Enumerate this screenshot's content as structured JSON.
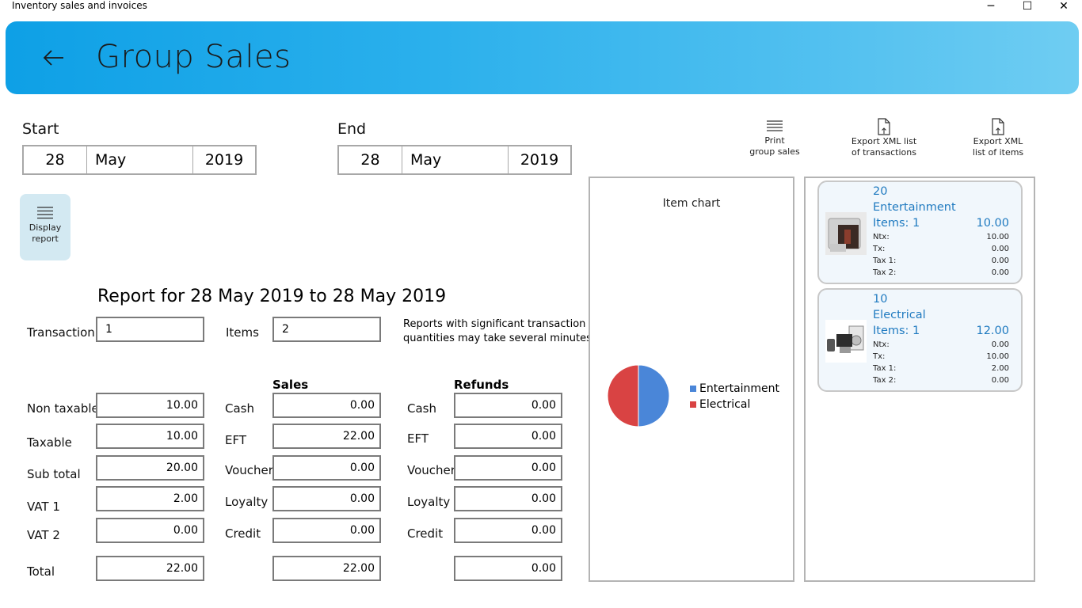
{
  "window": {
    "title": "Inventory sales and invoices",
    "minimize": "─",
    "maximize": "☐",
    "close": "✕"
  },
  "header": {
    "title": "Group Sales"
  },
  "start": {
    "label": "Start",
    "day": "28",
    "month": "May",
    "year": "2019"
  },
  "end": {
    "label": "End",
    "day": "28",
    "month": "May",
    "year": "2019"
  },
  "toolbar": {
    "display_report": [
      "Display",
      "report"
    ],
    "print_group_sales": [
      "Print",
      "group sales"
    ],
    "export_transactions": [
      "Export XML list",
      "of transactions"
    ],
    "export_items": [
      "Export XML",
      "list of items"
    ]
  },
  "report": {
    "title": "Report for 28 May 2019 to 28 May 2019",
    "transaction_label": "Transaction",
    "transaction_value": "1",
    "items_label": "Items",
    "items_value": "2",
    "note_line1": "Reports with significant transaction",
    "note_line2": "quantities may take several minutes."
  },
  "summary": {
    "rows": [
      {
        "label": "Non taxable",
        "value": "10.00"
      },
      {
        "label": "Taxable",
        "value": "10.00"
      },
      {
        "label": "Sub total",
        "value": "20.00"
      },
      {
        "label": "VAT 1",
        "value": "2.00"
      },
      {
        "label": "VAT 2",
        "value": "0.00"
      },
      {
        "label": "Total",
        "value": "22.00"
      }
    ]
  },
  "sales": {
    "heading": "Sales",
    "rows": [
      {
        "label": "Cash",
        "value": "0.00"
      },
      {
        "label": "EFT",
        "value": "22.00"
      },
      {
        "label": "Voucher",
        "value": "0.00"
      },
      {
        "label": "Loyalty",
        "value": "0.00"
      },
      {
        "label": "Credit",
        "value": "0.00"
      }
    ],
    "total": "22.00"
  },
  "refunds": {
    "heading": "Refunds",
    "rows": [
      {
        "label": "Cash",
        "value": "0.00"
      },
      {
        "label": "EFT",
        "value": "0.00"
      },
      {
        "label": "Voucher",
        "value": "0.00"
      },
      {
        "label": "Loyalty",
        "value": "0.00"
      },
      {
        "label": "Credit",
        "value": "0.00"
      }
    ],
    "total": "0.00"
  },
  "chart": {
    "title": "Item chart",
    "colors": {
      "entertainment": "#4a86d8",
      "electrical": "#d94343"
    },
    "chart_data": {
      "type": "pie",
      "categories": [
        "Entertainment",
        "Electrical"
      ],
      "values": [
        1,
        1
      ],
      "title": "Item chart",
      "legend": "right"
    }
  },
  "cards": [
    {
      "code": "20",
      "group": "Entertainment",
      "items": "Items: 1",
      "amount": "10.00",
      "ntx_label": "Ntx:",
      "ntx": "10.00",
      "tx_label": "Tx:",
      "tx": "0.00",
      "tax1_label": "Tax 1:",
      "tax1": "0.00",
      "tax2_label": "Tax 2:",
      "tax2": "0.00",
      "icon": "entertainment-product-icon"
    },
    {
      "code": "10",
      "group": "Electrical",
      "items": "Items: 1",
      "amount": "12.00",
      "ntx_label": "Ntx:",
      "ntx": "0.00",
      "tx_label": "Tx:",
      "tx": "10.00",
      "tax1_label": "Tax 1:",
      "tax1": "2.00",
      "tax2_label": "Tax 2:",
      "tax2": "0.00",
      "icon": "electrical-appliances-icon"
    }
  ]
}
